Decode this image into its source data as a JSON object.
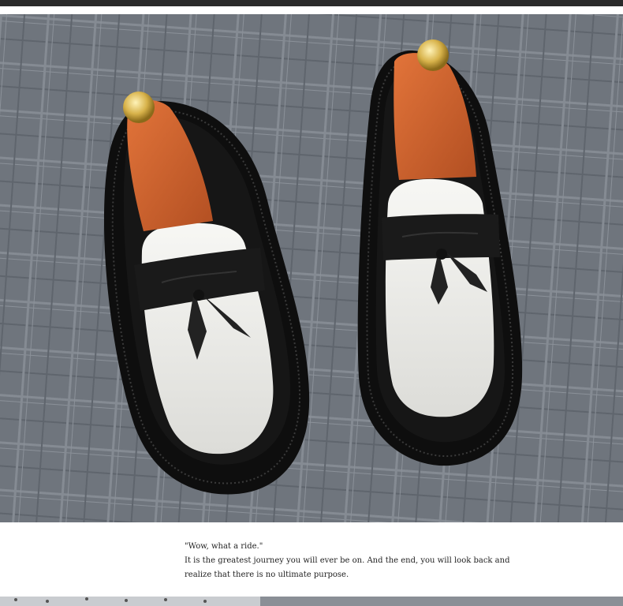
{
  "caption": {
    "quote": "\"Wow, what a ride.\"",
    "line1": "It is the greatest journey you will ever be on. And the end, you will look back and",
    "line2": "realize that there is no ultimate purpose."
  },
  "colors": {
    "background_slate": "#6e747c",
    "shoe_black": "#141414",
    "shoe_white": "#ecece8",
    "shoe_tree_wood": "#c9602e",
    "knob_gold": "#d7b24a"
  },
  "icons": [
    "shoe-left-icon",
    "shoe-right-icon"
  ]
}
